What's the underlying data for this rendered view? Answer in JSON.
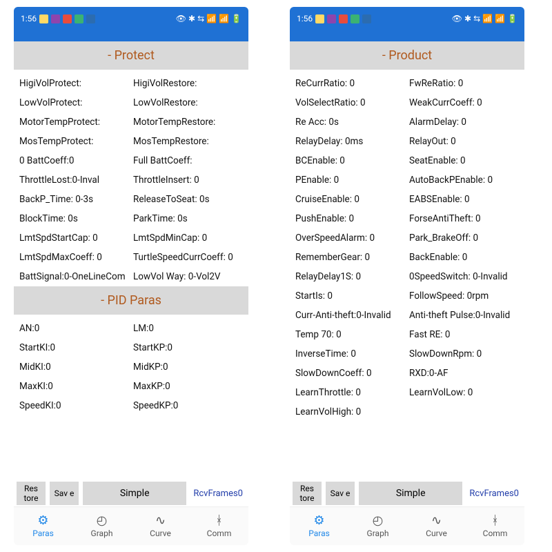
{
  "status": {
    "time": "1:56",
    "icons_right": "◉ ✱ ⇆ ₅ ₅ ᴳ ▯"
  },
  "left": {
    "sections": [
      {
        "title": "- Protect",
        "rows": [
          [
            "HigiVolProtect:",
            "HigiVolRestore:"
          ],
          [
            "LowVolProtect:",
            "LowVolRestore:"
          ],
          [
            "MotorTempProtect:",
            "MotorTempRestore:"
          ],
          [
            "MosTempProtect:",
            "MosTempRestore:"
          ],
          [
            "0 BattCoeff:0",
            "Full BattCoeff:"
          ],
          [
            "ThrottleLost:0-Inval",
            "ThrottleInsert:   0"
          ],
          [
            "BackP_Time: 0-3s",
            "ReleaseToSeat:   0s"
          ],
          [
            "BlockTime:   0s",
            "ParkTime:   0s"
          ],
          [
            "LmtSpdStartCap:   0",
            "LmtSpdMinCap:   0"
          ],
          [
            "LmtSpdMaxCoeff:   0",
            "TurtleSpeedCurrCoeff:   0"
          ],
          [
            "BattSignal:0-OneLineCom",
            "LowVol Way: 0-Vol2V"
          ]
        ]
      },
      {
        "title": "- PID Paras",
        "rows": [
          [
            "AN:0",
            "LM:0"
          ],
          [
            "StartKI:0",
            "StartKP:0"
          ],
          [
            "MidKI:0",
            "MidKP:0"
          ],
          [
            "MaxKI:0",
            "MaxKP:0"
          ],
          [
            "SpeedKI:0",
            "SpeedKP:0"
          ]
        ]
      }
    ]
  },
  "right": {
    "sections": [
      {
        "title": "- Product",
        "rows": [
          [
            "ReCurrRatio:   0",
            "FwReRatio:   0"
          ],
          [
            "VolSelectRatio:   0",
            "WeakCurrCoeff:   0"
          ],
          [
            "Re Acc:   0s",
            "AlarmDelay:   0"
          ],
          [
            "RelayDelay:   0ms",
            "RelayOut:   0"
          ],
          [
            "BCEnable:   0",
            "SeatEnable:   0"
          ],
          [
            "PEnable:   0",
            "AutoBackPEnable:   0"
          ],
          [
            "CruiseEnable:   0",
            "EABSEnable:   0"
          ],
          [
            "PushEnable:   0",
            "ForseAntiTheft:   0"
          ],
          [
            "OverSpeedAlarm:   0",
            "Park_BrakeOff:   0"
          ],
          [
            "RememberGear:   0",
            "BackEnable:   0"
          ],
          [
            "RelayDelay1S:   0",
            "0SpeedSwitch: 0-Invalid"
          ],
          [
            "StartIs:   0",
            "FollowSpeed:   0rpm"
          ],
          [
            "Curr-Anti-theft:0-Invalid",
            "Anti-theft Pulse:0-Invalid"
          ],
          [
            "Temp 70: 0",
            "Fast RE: 0"
          ],
          [
            "InverseTime:   0",
            "SlowDownRpm:   0"
          ],
          [
            "SlowDownCoeff:   0",
            "RXD:0-AF"
          ],
          [
            "LearnThrottle:   0",
            "LearnVolLow:   0"
          ],
          [
            "LearnVolHigh:   0",
            ""
          ]
        ]
      }
    ]
  },
  "buttons": {
    "restore": "Res\ntore",
    "save": "Sav\ne",
    "simple": "Simple",
    "rcv": "RcvFrames0"
  },
  "nav": {
    "paras": "Paras",
    "graph": "Graph",
    "curve": "Curve",
    "comm": "Comm"
  }
}
